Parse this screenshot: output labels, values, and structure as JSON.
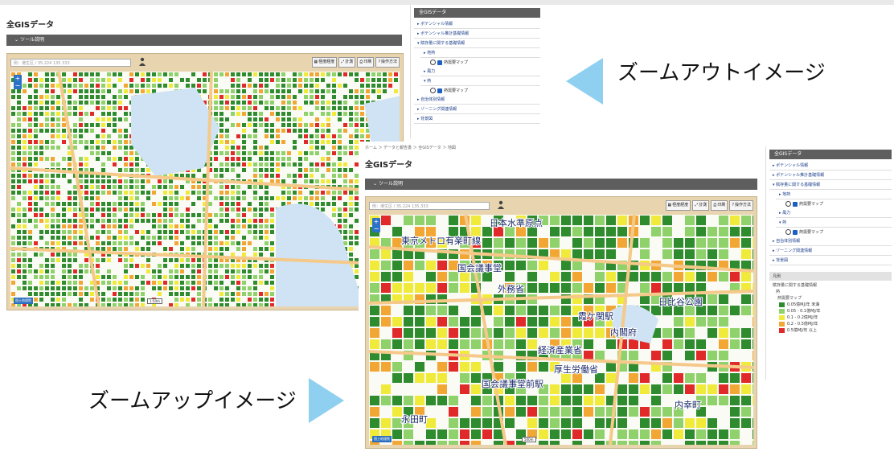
{
  "zoomout": {
    "page_title": "全GISデータ",
    "toolbar_label": "ツール説明",
    "search_placeholder": "例：港生区 / 35.224 135.333",
    "tools": [
      {
        "label": "極度経度",
        "icon": "latlon-icon"
      },
      {
        "label": "計測",
        "icon": "measure-icon"
      },
      {
        "label": "印刷",
        "icon": "print-icon"
      },
      {
        "label": "操作方法",
        "icon": "help-icon"
      }
    ],
    "attribution": "国土地理院",
    "scale": "1:50m",
    "panel": {
      "title": "全GISデータ",
      "items": [
        {
          "label": "▸ ポテンシャル情報",
          "level": 0
        },
        {
          "label": "▸ ポテンシャル推計基礎情報",
          "level": 0
        },
        {
          "label": "▾ 賦存量に関する基礎情報",
          "level": 0
        },
        {
          "label": "▸ 地熱",
          "level": 1
        },
        {
          "label": "▸ 風力",
          "level": 1
        },
        {
          "label": "▾ 熱",
          "level": 1
        },
        {
          "label": "▸ 自治体別情報",
          "level": 0
        },
        {
          "label": "▸ ゾーニング関連情報",
          "level": 0
        },
        {
          "label": "▸ 背景図",
          "level": 0
        }
      ],
      "checked_layer": "熱需要マップ"
    }
  },
  "zoomup": {
    "breadcrumb": "ホーム ＞ データと報告書 ＞ 全GISデータ ＞ 地図",
    "page_title": "全GISデータ",
    "toolbar_label": "ツール説明",
    "search_placeholder": "例：港生区 / 35.224 135.333",
    "tools": [
      {
        "label": "極度経度",
        "icon": "latlon-icon"
      },
      {
        "label": "計測",
        "icon": "measure-icon"
      },
      {
        "label": "印刷",
        "icon": "print-icon"
      },
      {
        "label": "操作方法",
        "icon": "help-icon"
      }
    ],
    "attribution": "国土地理院",
    "scale": "500m",
    "map_labels": [
      "日本水準原点",
      "東京メトロ有楽町線",
      "国会議事堂",
      "外務省",
      "日比谷公園",
      "霞ケ関駅",
      "内閣府",
      "経済産業省",
      "厚生労働省",
      "国会議事堂前駅",
      "内幸町",
      "永田町"
    ],
    "panel": {
      "title": "全GISデータ",
      "items": [
        {
          "label": "▸ ポテンシャル情報",
          "level": 0
        },
        {
          "label": "▸ ポテンシャル推計基礎情報",
          "level": 0
        },
        {
          "label": "▾ 賦存量に関する基礎情報",
          "level": 0
        },
        {
          "label": "▸ 地熱",
          "level": 1
        },
        {
          "label": "▸ 風力",
          "level": 1
        },
        {
          "label": "▾ 熱",
          "level": 1
        },
        {
          "label": "▸ 自治体別情報",
          "level": 0
        },
        {
          "label": "▸ ゾーニング関連情報",
          "level": 0
        },
        {
          "label": "▸ 背景図",
          "level": 0
        }
      ],
      "checked_layer": "熱需要マップ",
      "legend": {
        "title": "凡例",
        "group": "賦存量に関する基礎情報",
        "subgroup": "熱",
        "layer": "熱需要マップ",
        "entries": [
          {
            "label": "0.05億MJ/年 未満",
            "color": "#2e8b2e"
          },
          {
            "label": "0.05 - 0.1億MJ/年",
            "color": "#8fd16a"
          },
          {
            "label": "0.1 - 0.2億MJ/年",
            "color": "#f0ea3a"
          },
          {
            "label": "0.2 - 0.5億MJ/年",
            "color": "#f2a634"
          },
          {
            "label": "0.5億MJ/年 以上",
            "color": "#e02a2a"
          }
        ]
      }
    }
  },
  "captions": {
    "zoomout": "ズームアウトイメージ",
    "zoomup": "ズームアップイメージ"
  },
  "colors": {
    "arrow": "#8fd0f0",
    "toolbar": "#5e5e5e",
    "frame": "#e8d5b0",
    "water": "#cfe3f4"
  }
}
